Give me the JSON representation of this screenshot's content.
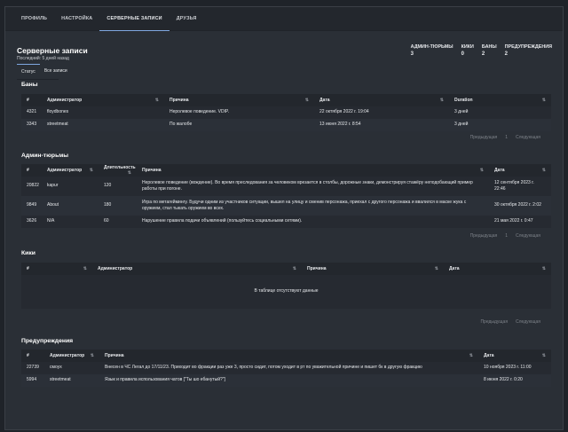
{
  "tabs": [
    "ПРОФИЛЬ",
    "НАСТРОЙКА",
    "СЕРВЕРНЫЕ ЗАПИСИ",
    "ДРУЗЬЯ"
  ],
  "active_tab": 2,
  "header": {
    "title": "Серверные записи",
    "subtitle": "Последний: 5 дней назад",
    "stats": [
      {
        "label": "АДМИН-ТЮРЬМЫ",
        "value": "3"
      },
      {
        "label": "КИКИ",
        "value": "0"
      },
      {
        "label": "БАНЫ",
        "value": "2"
      },
      {
        "label": "ПРЕДУПРЕЖДЕНИЯ",
        "value": "2"
      }
    ]
  },
  "subtabs": [
    "Статус",
    "Все записи"
  ],
  "pager": {
    "prev": "Предыдущая",
    "page": "1",
    "next": "Следующая"
  },
  "bans": {
    "title": "Баны",
    "columns": [
      "#",
      "Администратор",
      "Причина",
      "Дата",
      "Duration"
    ],
    "rows": [
      [
        "4321",
        "floydbones",
        "Неролевое поведение. VDIP.",
        "22 октября 2022 г. 19:04",
        "3 дней"
      ],
      [
        "3343",
        "streetmeat",
        "По жалобе",
        "13 июня 2022 г. 8:54",
        "3 дней"
      ]
    ]
  },
  "jails": {
    "title": "Админ-тюрьмы",
    "columns": [
      "#",
      "Администратор",
      "Длительность",
      "Причина",
      "Дата"
    ],
    "rows": [
      [
        "20822",
        "kapur",
        "120",
        "Неролевое поведение (вождение). Во время преследования за человеком врезается в столбы, дорожные знаки, демонстрируя стажёру неподобающий пример работы при погоне.",
        "12 сентября 2023 г. 22:46"
      ],
      [
        "9849",
        "About",
        "180",
        "Игра по метагеймингу. Будучи одним из участников ситуации, вышел на улицу и сменив персонажа, приехал с другого персонажа и ввалился в маске жука с оружием, стал тыкать оружием во всех.",
        "30 октября 2022 г. 2:02"
      ],
      [
        "3626",
        "N/A",
        "60",
        "Нарушение правила подачи объявлений (пользуйтесь социальными сетями).",
        "21 мая 2022 г. 0:47"
      ]
    ]
  },
  "kicks": {
    "title": "Кики",
    "columns": [
      "#",
      "Администратор",
      "Причина",
      "Дата"
    ],
    "empty": "В таблице отсутствуют данные"
  },
  "warnings": {
    "title": "Предупреждения",
    "columns": [
      "#",
      "Администратор",
      "Причина",
      "Дата"
    ],
    "rows": [
      [
        "22739",
        "cмoyx",
        "Внесен в ЧС Легал до 17/11/23. Приходит во фракции раз уже 3, просто сидит, потом уходит в рт по уважительной причине и пишет бк в другую фракцию",
        "10 ноября 2023 г. 11:00"
      ],
      [
        "5994",
        "streetmeat",
        "Язык и правила использования чатов [\"Ты шо ебанутый?\"]",
        "8 июня 2022 г. 0:20"
      ]
    ]
  }
}
